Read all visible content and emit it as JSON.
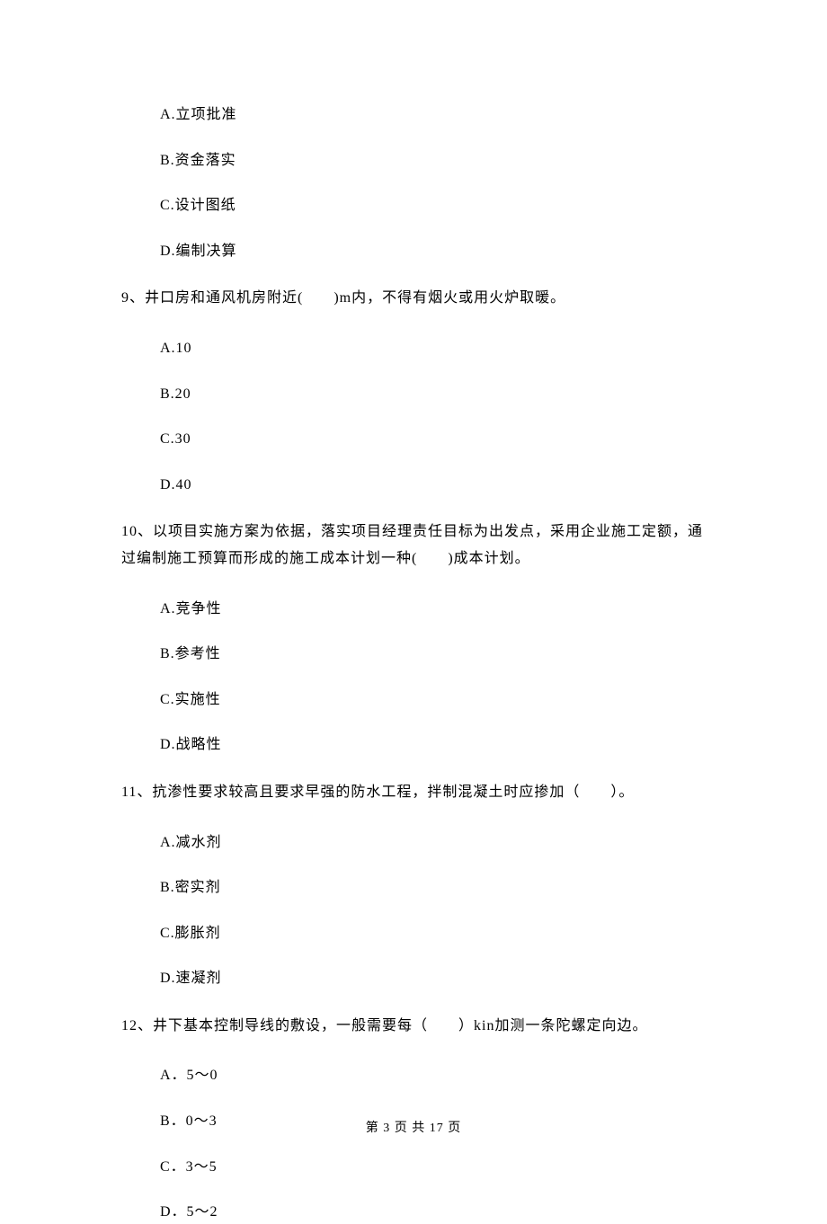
{
  "options8": {
    "a": "A.立项批准",
    "b": "B.资金落实",
    "c": "C.设计图纸",
    "d": "D.编制决算"
  },
  "q9": {
    "text": "9、井口房和通风机房附近(　　)m内，不得有烟火或用火炉取暖。",
    "a": "A.10",
    "b": "B.20",
    "c": "C.30",
    "d": "D.40"
  },
  "q10": {
    "text": "10、以项目实施方案为依据，落实项目经理责任目标为出发点，采用企业施工定额，通过编制施工预算而形成的施工成本计划一种(　　)成本计划。",
    "a": "A.竞争性",
    "b": "B.参考性",
    "c": "C.实施性",
    "d": "D.战略性"
  },
  "q11": {
    "text": "11、抗渗性要求较高且要求早强的防水工程，拌制混凝土时应掺加（　　）。",
    "a": "A.减水剂",
    "b": "B.密实剂",
    "c": "C.膨胀剂",
    "d": "D.速凝剂"
  },
  "q12": {
    "text": "12、井下基本控制导线的敷设，一般需要每（　　）kin加测一条陀螺定向边。",
    "a": "A．5～0",
    "b": "B．0～3",
    "c": "C．3～5",
    "d": "D．5～2"
  },
  "footer": "第 3 页 共 17 页"
}
